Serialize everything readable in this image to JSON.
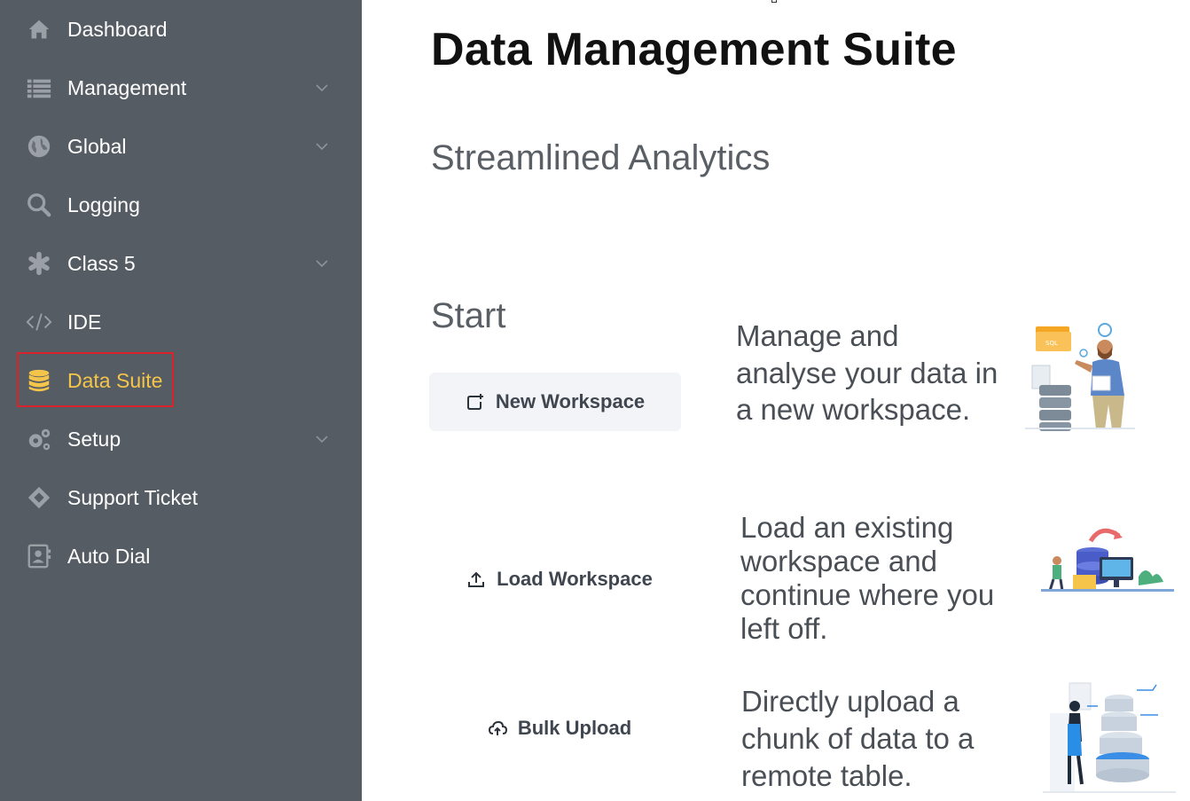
{
  "sidebar": {
    "items": [
      {
        "label": "Dashboard",
        "icon": "home-icon",
        "has_chevron": false
      },
      {
        "label": "Management",
        "icon": "list-icon",
        "has_chevron": true
      },
      {
        "label": "Global",
        "icon": "globe-icon",
        "has_chevron": true
      },
      {
        "label": "Logging",
        "icon": "search-icon",
        "has_chevron": false
      },
      {
        "label": "Class 5",
        "icon": "asterisk-icon",
        "has_chevron": true
      },
      {
        "label": "IDE",
        "icon": "code-icon",
        "has_chevron": false
      },
      {
        "label": "Data Suite",
        "icon": "database-icon",
        "has_chevron": false,
        "active": true
      },
      {
        "label": "Setup",
        "icon": "gears-icon",
        "has_chevron": true
      },
      {
        "label": "Support Ticket",
        "icon": "ticket-icon",
        "has_chevron": false
      },
      {
        "label": "Auto Dial",
        "icon": "contact-card-icon",
        "has_chevron": false
      }
    ],
    "colors": {
      "background": "#555c63",
      "text": "#ffffff",
      "active_text": "#f5c54b",
      "active_outline": "#d9232b"
    }
  },
  "main": {
    "title": "Data Management Suite",
    "subtitle": "Streamlined Analytics",
    "section_title": "Start",
    "actions": [
      {
        "label": "New Workspace",
        "icon": "new-window-icon",
        "description": "Manage and analyse your data in a new workspace."
      },
      {
        "label": "Load Workspace",
        "icon": "upload-icon",
        "description": "Load an existing workspace and continue where you left off."
      },
      {
        "label": "Bulk Upload",
        "icon": "cloud-upload-icon",
        "description": "Directly upload a chunk of data to a remote table."
      }
    ]
  }
}
